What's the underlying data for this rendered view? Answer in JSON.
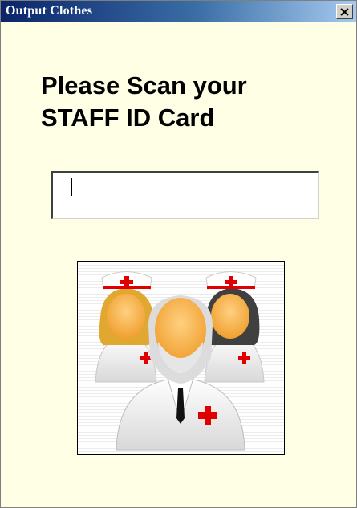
{
  "window": {
    "title": "Output Clothes",
    "close_icon": "close-icon"
  },
  "prompt": {
    "line1": "Please Scan your",
    "line2": "STAFF ID Card"
  },
  "id_input": {
    "value": "",
    "placeholder": ""
  },
  "image": {
    "icon": "medical-staff-icon"
  },
  "colors": {
    "background": "#ffffe6",
    "titlebar_start": "#0a246a",
    "titlebar_end": "#a6caf0",
    "red_cross": "#e00000"
  }
}
